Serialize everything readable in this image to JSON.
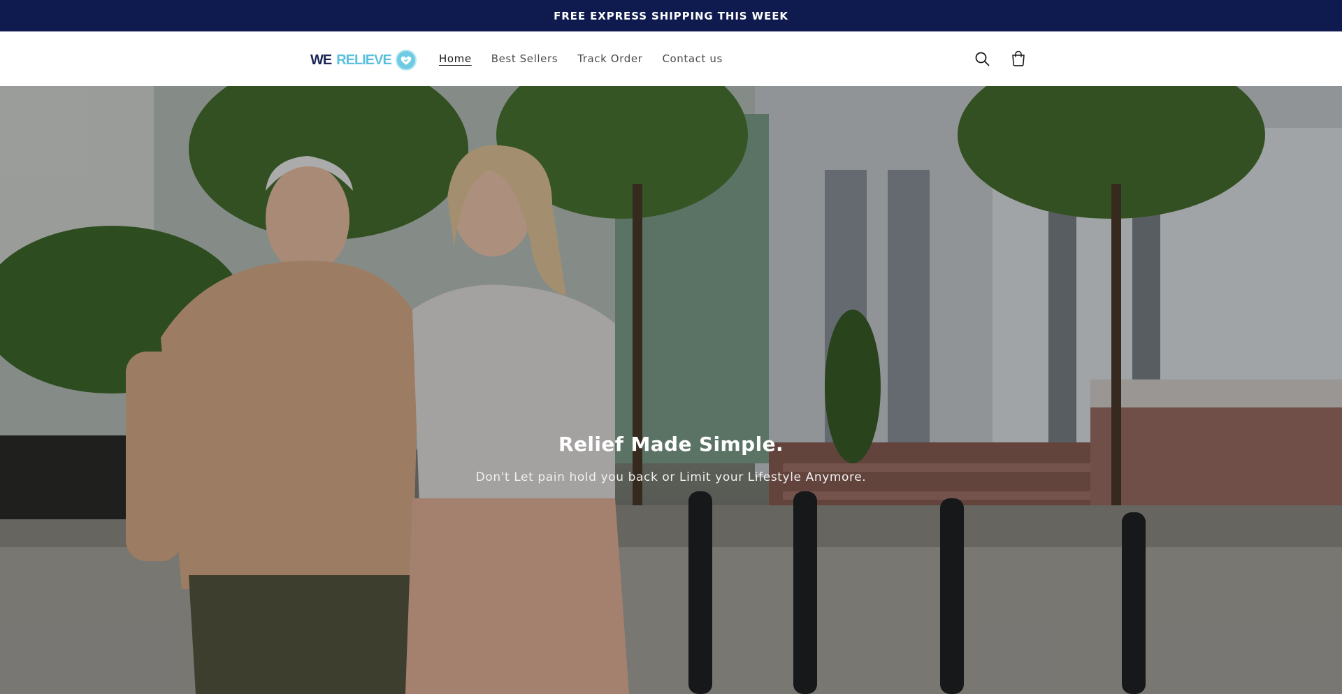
{
  "announcement": {
    "text": "FREE EXPRESS SHIPPING THIS WEEK"
  },
  "header": {
    "logo": {
      "word1": "WE",
      "word2": "RELIEVE",
      "icon": "heart-shield-icon"
    },
    "nav": [
      {
        "label": "Home",
        "active": true
      },
      {
        "label": "Best Sellers",
        "active": false
      },
      {
        "label": "Track Order",
        "active": false
      },
      {
        "label": "Contact us",
        "active": false
      }
    ],
    "icons": {
      "search": "search-icon",
      "cart": "cart-icon"
    }
  },
  "hero": {
    "title": "Relief Made Simple.",
    "subtitle": "Don't Let pain hold you back or Limit your Lifestyle Anymore."
  },
  "colors": {
    "announcement_bg": "#0f1b4f",
    "logo_dark": "#1d2658",
    "logo_light": "#5bc0de",
    "text": "#4a4a4a"
  }
}
